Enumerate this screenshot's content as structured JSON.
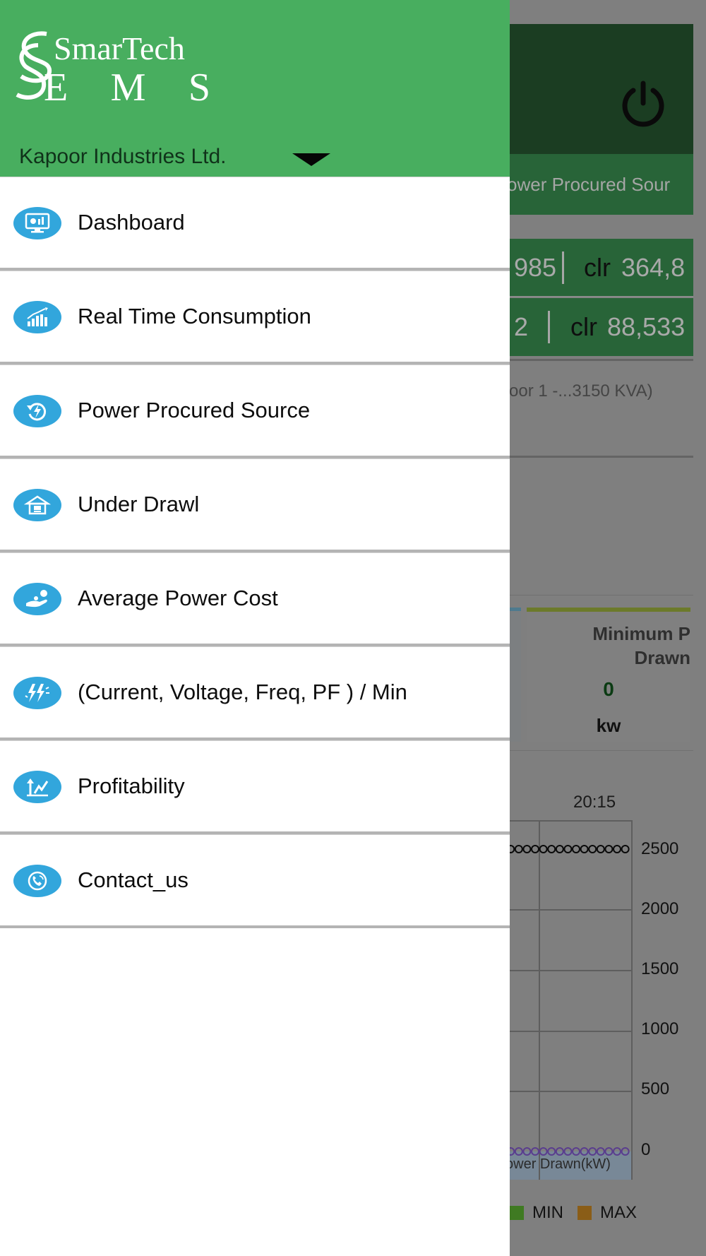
{
  "drawer": {
    "logo": {
      "line1": "SmarTech",
      "line2": "EMS"
    },
    "organization": "Kapoor Industries Ltd.",
    "menu": [
      {
        "label": "Dashboard",
        "icon": "dashboard-monitor-icon"
      },
      {
        "label": "Real Time Consumption",
        "icon": "bar-chart-growth-icon"
      },
      {
        "label": "Power Procured Source",
        "icon": "power-refresh-bolt-icon"
      },
      {
        "label": "Under Drawl",
        "icon": "factory-house-icon"
      },
      {
        "label": "Average Power Cost",
        "icon": "hand-coin-icon"
      },
      {
        "label": "(Current, Voltage, Freq, PF ) / Min",
        "icon": "lightning-bolts-icon"
      },
      {
        "label": "Profitability",
        "icon": "profit-trend-icon"
      },
      {
        "label": "Contact_us",
        "icon": "phone-handset-icon"
      }
    ],
    "accent_color": "#48ae5f",
    "icon_color": "#32a6dc"
  },
  "background": {
    "tab_text": "ower Procured Sour",
    "row1": {
      "left": "985",
      "label": "clr",
      "value": "364,8"
    },
    "row2": {
      "left": "2",
      "label": "clr",
      "value": "88,533"
    },
    "meter_text": "oor 1 -...3150 KVA)",
    "card": {
      "title_line1": "Minimum P",
      "title_line2": "Drawn",
      "value": "0",
      "unit": "kw"
    },
    "time_label": "20:15",
    "y_ticks": [
      "2500",
      "2000",
      "1500",
      "1000",
      "500",
      "0"
    ],
    "x_label": "ower Drawn(kW)",
    "legend": [
      {
        "name": "MIN",
        "color": "#3f7a22"
      },
      {
        "name": "MAX",
        "color": "#8a5d17"
      }
    ]
  }
}
